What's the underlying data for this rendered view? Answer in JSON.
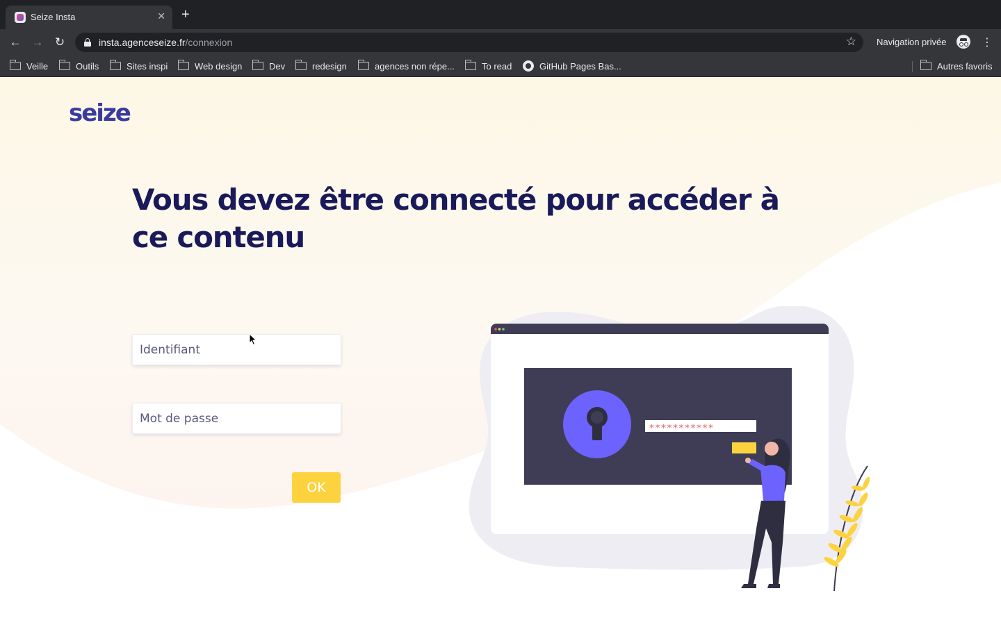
{
  "browser": {
    "tab": {
      "title": "Seize Insta",
      "close": "✕"
    },
    "new_tab": "+",
    "nav": {
      "back": "←",
      "forward": "→",
      "reload": "↻"
    },
    "address": {
      "host": "insta.agenceseize.fr",
      "path": "/connexion"
    },
    "star": "☆",
    "incognito_label": "Navigation privée",
    "menu": "⋮",
    "bookmarks": [
      {
        "label": "Veille",
        "icon": "folder-icon"
      },
      {
        "label": "Outils",
        "icon": "folder-icon"
      },
      {
        "label": "Sites inspi",
        "icon": "folder-icon"
      },
      {
        "label": "Web design",
        "icon": "folder-icon"
      },
      {
        "label": "Dev",
        "icon": "folder-icon"
      },
      {
        "label": "redesign",
        "icon": "folder-icon"
      },
      {
        "label": "agences non répe...",
        "icon": "folder-icon"
      },
      {
        "label": "To read",
        "icon": "folder-icon"
      },
      {
        "label": "GitHub Pages Bas...",
        "icon": "github-icon"
      }
    ],
    "other_bookmarks": "Autres favoris"
  },
  "page": {
    "logo": "seize",
    "heading": "Vous devez être connecté pour accéder à ce contenu",
    "form": {
      "login_placeholder": "Identifiant",
      "password_placeholder": "Mot de passe",
      "submit_label": "OK"
    },
    "illustration": {
      "masked_password": "***********",
      "icon": "keyhole-icon"
    }
  },
  "colors": {
    "heading": "#1a1a5a",
    "logo": "#3a3aa0",
    "button": "#fcd33f",
    "accent": "#6c63ff",
    "background_tint": "#fdf7e6"
  }
}
